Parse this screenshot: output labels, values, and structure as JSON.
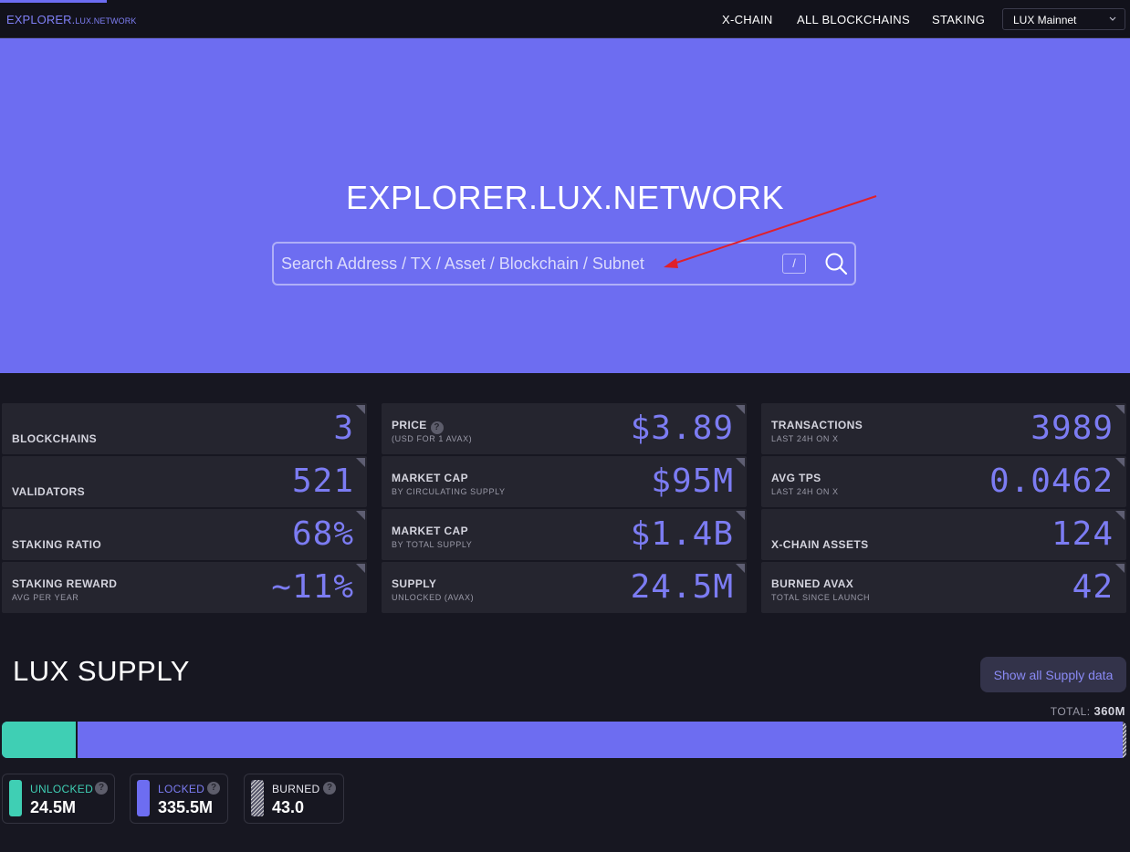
{
  "nav": {
    "brand_main": "EXPLORER.",
    "brand_small": "LUX.NETWORK",
    "links": [
      "X-CHAIN",
      "ALL BLOCKCHAINS",
      "STAKING"
    ],
    "network": "LUX Mainnet"
  },
  "hero": {
    "title": "EXPLORER.LUX.NETWORK",
    "search_placeholder": "Search Address / TX / Asset / Blockchain / Subnet",
    "shortcut_key": "/"
  },
  "stats": {
    "blockchains": {
      "label": "BLOCKCHAINS",
      "value": "3"
    },
    "validators": {
      "label": "VALIDATORS",
      "value": "521"
    },
    "staking_ratio": {
      "label": "STAKING RATIO",
      "value": "68%"
    },
    "staking_reward": {
      "label": "STAKING REWARD",
      "sub": "AVG PER YEAR",
      "value": "~11%"
    },
    "price": {
      "label": "PRICE",
      "sub": "(USD FOR 1 AVAX)",
      "value": "$3.89"
    },
    "market_cap_circ": {
      "label": "MARKET CAP",
      "sub": "BY CIRCULATING SUPPLY",
      "value": "$95M"
    },
    "market_cap_total": {
      "label": "MARKET CAP",
      "sub": "BY TOTAL SUPPLY",
      "value": "$1.4B"
    },
    "supply": {
      "label": "SUPPLY",
      "sub": "UNLOCKED (AVAX)",
      "value": "24.5M"
    },
    "transactions": {
      "label": "TRANSACTIONS",
      "sub": "LAST 24H ON X",
      "value": "3989"
    },
    "avg_tps": {
      "label": "AVG TPS",
      "sub": "LAST 24H ON X",
      "value": "0.0462"
    },
    "xchain_assets": {
      "label": "X-CHAIN ASSETS",
      "value": "124"
    },
    "burned": {
      "label": "BURNED AVAX",
      "sub": "TOTAL SINCE LAUNCH",
      "value": "42"
    }
  },
  "supply": {
    "title": "LUX SUPPLY",
    "button": "Show all Supply data",
    "total_label": "TOTAL:",
    "total_value": "360M",
    "segments": {
      "unlocked": {
        "name": "UNLOCKED",
        "display": "24.5M",
        "amount": 24.5,
        "color": "#3fcfb4"
      },
      "locked": {
        "name": "LOCKED",
        "display": "335.5M",
        "amount": 335.5,
        "color": "#6d6df1"
      },
      "burned": {
        "name": "BURNED",
        "display": "43.0",
        "amount": 4.3e-05
      }
    }
  },
  "colors": {
    "accent": "#6d6df1",
    "teal": "#3fcfb4",
    "background": "#171721",
    "card": "#25252f"
  }
}
